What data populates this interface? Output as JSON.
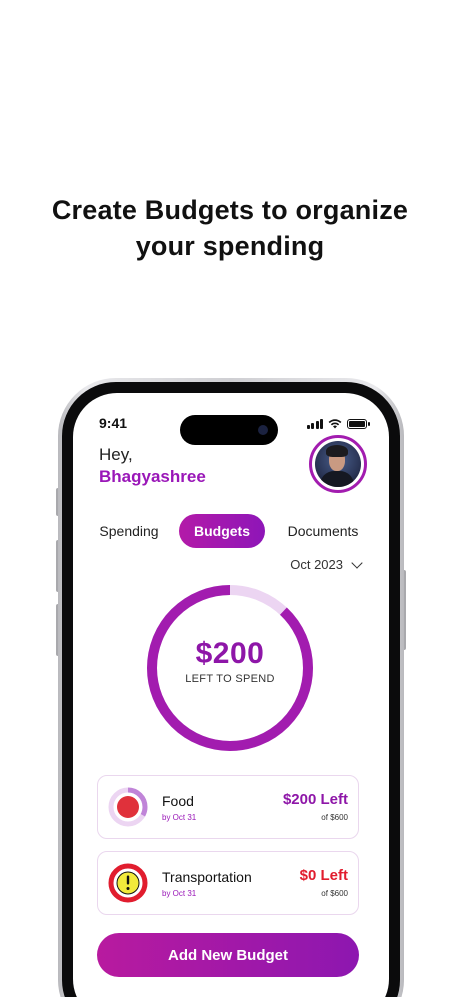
{
  "headline": {
    "line1": "Create Budgets to organize",
    "line2": "your spending"
  },
  "status_bar": {
    "time": "9:41"
  },
  "greeting": {
    "hey": "Hey,",
    "name": "Bhagyashree"
  },
  "tabs": [
    {
      "label": "Spending",
      "active": false
    },
    {
      "label": "Budgets",
      "active": true
    },
    {
      "label": "Documents",
      "active": false
    }
  ],
  "month_selector": {
    "value": "Oct 2023"
  },
  "summary": {
    "amount": "$200",
    "label": "LEFT TO SPEND",
    "spent_fraction": 0.12
  },
  "budgets": [
    {
      "title": "Food",
      "due": "by Oct 31",
      "left": "$200 Left",
      "of": "of $600",
      "status": "ok",
      "left_color": "#8e16a8",
      "ring_fraction": 0.33
    },
    {
      "title": "Transportation",
      "due": "by Oct 31",
      "left": "$0 Left",
      "of": "of $600",
      "status": "warning",
      "left_color": "#e11d2e",
      "ring_fraction": 1.0
    }
  ],
  "add_button": {
    "label": "Add New Budget"
  },
  "colors": {
    "accent": "#9a17b8",
    "ring": "#a21caf",
    "ring_track": "#ecd5f2",
    "danger": "#e11d2e"
  }
}
